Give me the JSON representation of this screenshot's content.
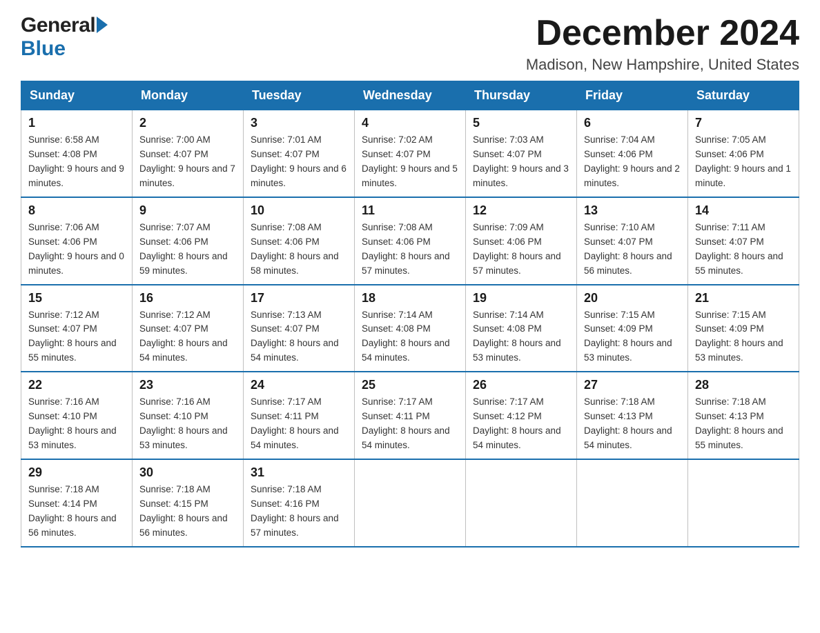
{
  "header": {
    "logo_general": "General",
    "logo_blue": "Blue",
    "month_title": "December 2024",
    "location": "Madison, New Hampshire, United States"
  },
  "weekdays": [
    "Sunday",
    "Monday",
    "Tuesday",
    "Wednesday",
    "Thursday",
    "Friday",
    "Saturday"
  ],
  "weeks": [
    [
      {
        "day": "1",
        "sunrise": "6:58 AM",
        "sunset": "4:08 PM",
        "daylight": "9 hours and 9 minutes."
      },
      {
        "day": "2",
        "sunrise": "7:00 AM",
        "sunset": "4:07 PM",
        "daylight": "9 hours and 7 minutes."
      },
      {
        "day": "3",
        "sunrise": "7:01 AM",
        "sunset": "4:07 PM",
        "daylight": "9 hours and 6 minutes."
      },
      {
        "day": "4",
        "sunrise": "7:02 AM",
        "sunset": "4:07 PM",
        "daylight": "9 hours and 5 minutes."
      },
      {
        "day": "5",
        "sunrise": "7:03 AM",
        "sunset": "4:07 PM",
        "daylight": "9 hours and 3 minutes."
      },
      {
        "day": "6",
        "sunrise": "7:04 AM",
        "sunset": "4:06 PM",
        "daylight": "9 hours and 2 minutes."
      },
      {
        "day": "7",
        "sunrise": "7:05 AM",
        "sunset": "4:06 PM",
        "daylight": "9 hours and 1 minute."
      }
    ],
    [
      {
        "day": "8",
        "sunrise": "7:06 AM",
        "sunset": "4:06 PM",
        "daylight": "9 hours and 0 minutes."
      },
      {
        "day": "9",
        "sunrise": "7:07 AM",
        "sunset": "4:06 PM",
        "daylight": "8 hours and 59 minutes."
      },
      {
        "day": "10",
        "sunrise": "7:08 AM",
        "sunset": "4:06 PM",
        "daylight": "8 hours and 58 minutes."
      },
      {
        "day": "11",
        "sunrise": "7:08 AM",
        "sunset": "4:06 PM",
        "daylight": "8 hours and 57 minutes."
      },
      {
        "day": "12",
        "sunrise": "7:09 AM",
        "sunset": "4:06 PM",
        "daylight": "8 hours and 57 minutes."
      },
      {
        "day": "13",
        "sunrise": "7:10 AM",
        "sunset": "4:07 PM",
        "daylight": "8 hours and 56 minutes."
      },
      {
        "day": "14",
        "sunrise": "7:11 AM",
        "sunset": "4:07 PM",
        "daylight": "8 hours and 55 minutes."
      }
    ],
    [
      {
        "day": "15",
        "sunrise": "7:12 AM",
        "sunset": "4:07 PM",
        "daylight": "8 hours and 55 minutes."
      },
      {
        "day": "16",
        "sunrise": "7:12 AM",
        "sunset": "4:07 PM",
        "daylight": "8 hours and 54 minutes."
      },
      {
        "day": "17",
        "sunrise": "7:13 AM",
        "sunset": "4:07 PM",
        "daylight": "8 hours and 54 minutes."
      },
      {
        "day": "18",
        "sunrise": "7:14 AM",
        "sunset": "4:08 PM",
        "daylight": "8 hours and 54 minutes."
      },
      {
        "day": "19",
        "sunrise": "7:14 AM",
        "sunset": "4:08 PM",
        "daylight": "8 hours and 53 minutes."
      },
      {
        "day": "20",
        "sunrise": "7:15 AM",
        "sunset": "4:09 PM",
        "daylight": "8 hours and 53 minutes."
      },
      {
        "day": "21",
        "sunrise": "7:15 AM",
        "sunset": "4:09 PM",
        "daylight": "8 hours and 53 minutes."
      }
    ],
    [
      {
        "day": "22",
        "sunrise": "7:16 AM",
        "sunset": "4:10 PM",
        "daylight": "8 hours and 53 minutes."
      },
      {
        "day": "23",
        "sunrise": "7:16 AM",
        "sunset": "4:10 PM",
        "daylight": "8 hours and 53 minutes."
      },
      {
        "day": "24",
        "sunrise": "7:17 AM",
        "sunset": "4:11 PM",
        "daylight": "8 hours and 54 minutes."
      },
      {
        "day": "25",
        "sunrise": "7:17 AM",
        "sunset": "4:11 PM",
        "daylight": "8 hours and 54 minutes."
      },
      {
        "day": "26",
        "sunrise": "7:17 AM",
        "sunset": "4:12 PM",
        "daylight": "8 hours and 54 minutes."
      },
      {
        "day": "27",
        "sunrise": "7:18 AM",
        "sunset": "4:13 PM",
        "daylight": "8 hours and 54 minutes."
      },
      {
        "day": "28",
        "sunrise": "7:18 AM",
        "sunset": "4:13 PM",
        "daylight": "8 hours and 55 minutes."
      }
    ],
    [
      {
        "day": "29",
        "sunrise": "7:18 AM",
        "sunset": "4:14 PM",
        "daylight": "8 hours and 56 minutes."
      },
      {
        "day": "30",
        "sunrise": "7:18 AM",
        "sunset": "4:15 PM",
        "daylight": "8 hours and 56 minutes."
      },
      {
        "day": "31",
        "sunrise": "7:18 AM",
        "sunset": "4:16 PM",
        "daylight": "8 hours and 57 minutes."
      },
      null,
      null,
      null,
      null
    ]
  ],
  "labels": {
    "sunrise": "Sunrise:",
    "sunset": "Sunset:",
    "daylight": "Daylight:"
  }
}
